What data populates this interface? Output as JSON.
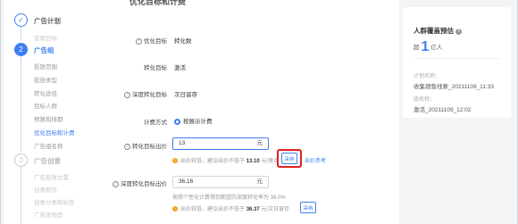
{
  "sidebar": {
    "steps": [
      {
        "number": "✓",
        "title": "广告计划",
        "state": "done"
      },
      {
        "number": "2",
        "title": "广告组",
        "state": "active"
      },
      {
        "number": "3",
        "title": "广告创意",
        "state": "todo"
      }
    ],
    "plan_items": [
      "营销目标"
    ],
    "group_items": [
      "投放范围",
      "投放类型",
      "转化途径",
      "目标人群",
      "预算和排期",
      "优化目标和计费",
      "广告组名称"
    ],
    "creative_items": [
      "广告投放位置",
      "创意制作",
      "创意分类和标签",
      "广告落地页"
    ]
  },
  "main": {
    "section_title_cut": "优化目标和计费",
    "optimization_goal": {
      "label": "优化目标",
      "value": "转化数"
    },
    "conversion_goal": {
      "label": "转化目标",
      "value": "激活"
    },
    "deep_conversion_goal": {
      "label": "深度转化目标",
      "value": "次日留存"
    },
    "billing_method": {
      "label": "计费方式",
      "value": "按展示计费"
    },
    "conversion_bid": {
      "label": "转化目标出价",
      "value": "13",
      "unit": "元",
      "hint_prefix": "出价较低，建议出价不低于",
      "hint_amount": "13.10",
      "hint_suffix": "元/激活",
      "adopt_label": "采纳",
      "reference_link": "出价参考"
    },
    "deep_bid": {
      "label": "深度转化目标出价",
      "value": "36.16",
      "unit": "元",
      "hint_ratio": "按照个性化计算得到期望的深度转化率为 36.0%",
      "hint_prefix": "出价较低，建议出价不低于",
      "hint_amount": "36.37",
      "hint_suffix": "元/次日留存",
      "adopt_label": "采纳"
    }
  },
  "estimate_card": {
    "title": "人群覆盖预估",
    "reach_prefix": "超",
    "reach_number": "1",
    "reach_unit": "亿人",
    "plan_name_label": "计划名称：",
    "plan_name_value": "收集销售线索_20211109_11:33",
    "group_name_label": "组名称：",
    "group_name_value": "激活_20211109_12:02"
  },
  "colors": {
    "accent": "#3d7ff2",
    "warning": "#f0a020",
    "highlight_box": "#e02020"
  }
}
